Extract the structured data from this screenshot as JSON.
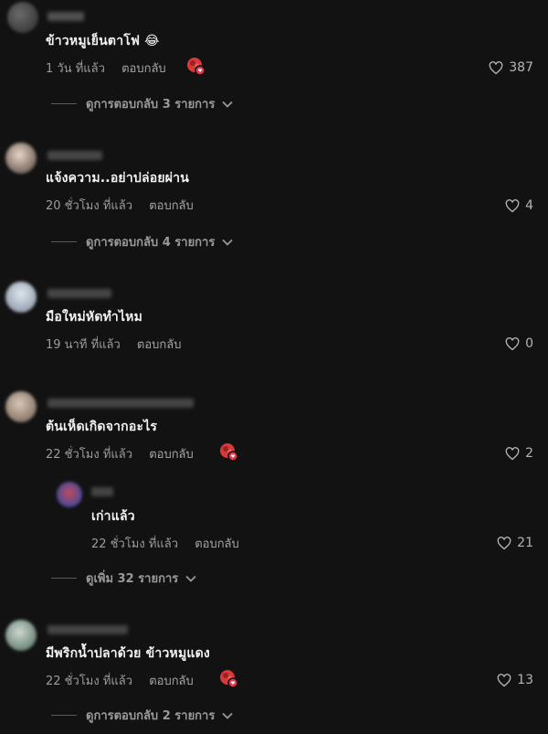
{
  "comments": [
    {
      "text": "ข้าวหมูเย็นตาโฟ 😂",
      "time": "1 วัน ที่แล้ว",
      "reply_label": "ตอบกลับ",
      "likes": "387",
      "has_creator_badge": true,
      "view_replies": "ดูการตอบกลับ 3 รายการ"
    },
    {
      "text": "แจ้งความ..อย่าปล่อยผ่าน",
      "time": "20 ชั่วโมง ที่แล้ว",
      "reply_label": "ตอบกลับ",
      "likes": "4",
      "has_creator_badge": false,
      "view_replies": "ดูการตอบกลับ 4 รายการ"
    },
    {
      "text": "มือใหม่หัดทำไหม",
      "time": "19 นาที ที่แล้ว",
      "reply_label": "ตอบกลับ",
      "likes": "0",
      "has_creator_badge": false
    },
    {
      "text": "ต้นเห็ดเกิดจากอะไร",
      "time": "22 ชั่วโมง ที่แล้ว",
      "reply_label": "ตอบกลับ",
      "likes": "2",
      "has_creator_badge": true,
      "reply": {
        "text": "เก่าแล้ว",
        "time": "22 ชั่วโมง ที่แล้ว",
        "reply_label": "ตอบกลับ",
        "likes": "21"
      },
      "view_more": "ดูเพิ่ม 32 รายการ"
    },
    {
      "text": "มีพริกน้ำปลาด้วย ข้าวหมูแดง",
      "time": "22 ชั่วโมง ที่แล้ว",
      "reply_label": "ตอบกลับ",
      "likes": "13",
      "has_creator_badge": true,
      "view_replies": "ดูการตอบกลับ 2 รายการ"
    }
  ],
  "colors": {
    "background": "#121212",
    "text": "#f2f2f2",
    "meta": "#9c9c9c",
    "creator_badge": "#e53935"
  }
}
